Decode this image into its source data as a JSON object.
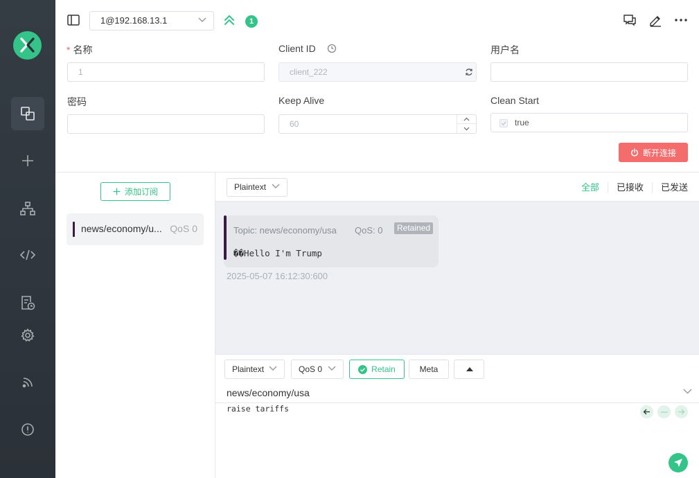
{
  "colors": {
    "accent": "#34c388",
    "danger": "#f56c6c",
    "sidebar": "#2f363d",
    "topic_bar": "#3b1a46"
  },
  "sidebar": {
    "items": [
      {
        "name": "connections",
        "icon": "connections-icon",
        "active": true
      },
      {
        "name": "new-connection",
        "icon": "plus-icon"
      },
      {
        "name": "topic-tree",
        "icon": "tree-icon"
      },
      {
        "name": "script",
        "icon": "code-icon"
      },
      {
        "name": "log",
        "icon": "log-icon"
      },
      {
        "name": "settings",
        "icon": "gear-icon"
      },
      {
        "name": "subscribe-feed",
        "icon": "rss-icon"
      },
      {
        "name": "about",
        "icon": "info-icon"
      }
    ]
  },
  "topbar": {
    "connection": "1@192.168.13.1",
    "badge_count": "1"
  },
  "form": {
    "name_label": "名称",
    "name_value": "1",
    "client_id_label": "Client ID",
    "client_id_value": "client_222",
    "username_label": "用户名",
    "username_value": "",
    "password_label": "密码",
    "password_value": "",
    "keepalive_label": "Keep Alive",
    "keepalive_value": "60",
    "clean_start_label": "Clean Start",
    "clean_start_value": "true",
    "disconnect_label": "断开连接"
  },
  "subscriptions": {
    "add_label": "添加订阅",
    "items": [
      {
        "topic": "news/economy/u...",
        "qos": "QoS 0"
      }
    ]
  },
  "messages": {
    "format": "Plaintext",
    "tabs": [
      "全部",
      "已接收",
      "已发送"
    ],
    "items": [
      {
        "topic": "Topic: news/economy/usa",
        "qos": "QoS: 0",
        "tag": "Retained",
        "payload": "��Hello I'm Trump",
        "time": "2025-05-07 16:12:30:600"
      }
    ]
  },
  "publish": {
    "format": "Plaintext",
    "qos": "QoS 0",
    "retain_label": "Retain",
    "meta_label": "Meta",
    "topic": "news/economy/usa",
    "payload": "raise tariffs"
  }
}
